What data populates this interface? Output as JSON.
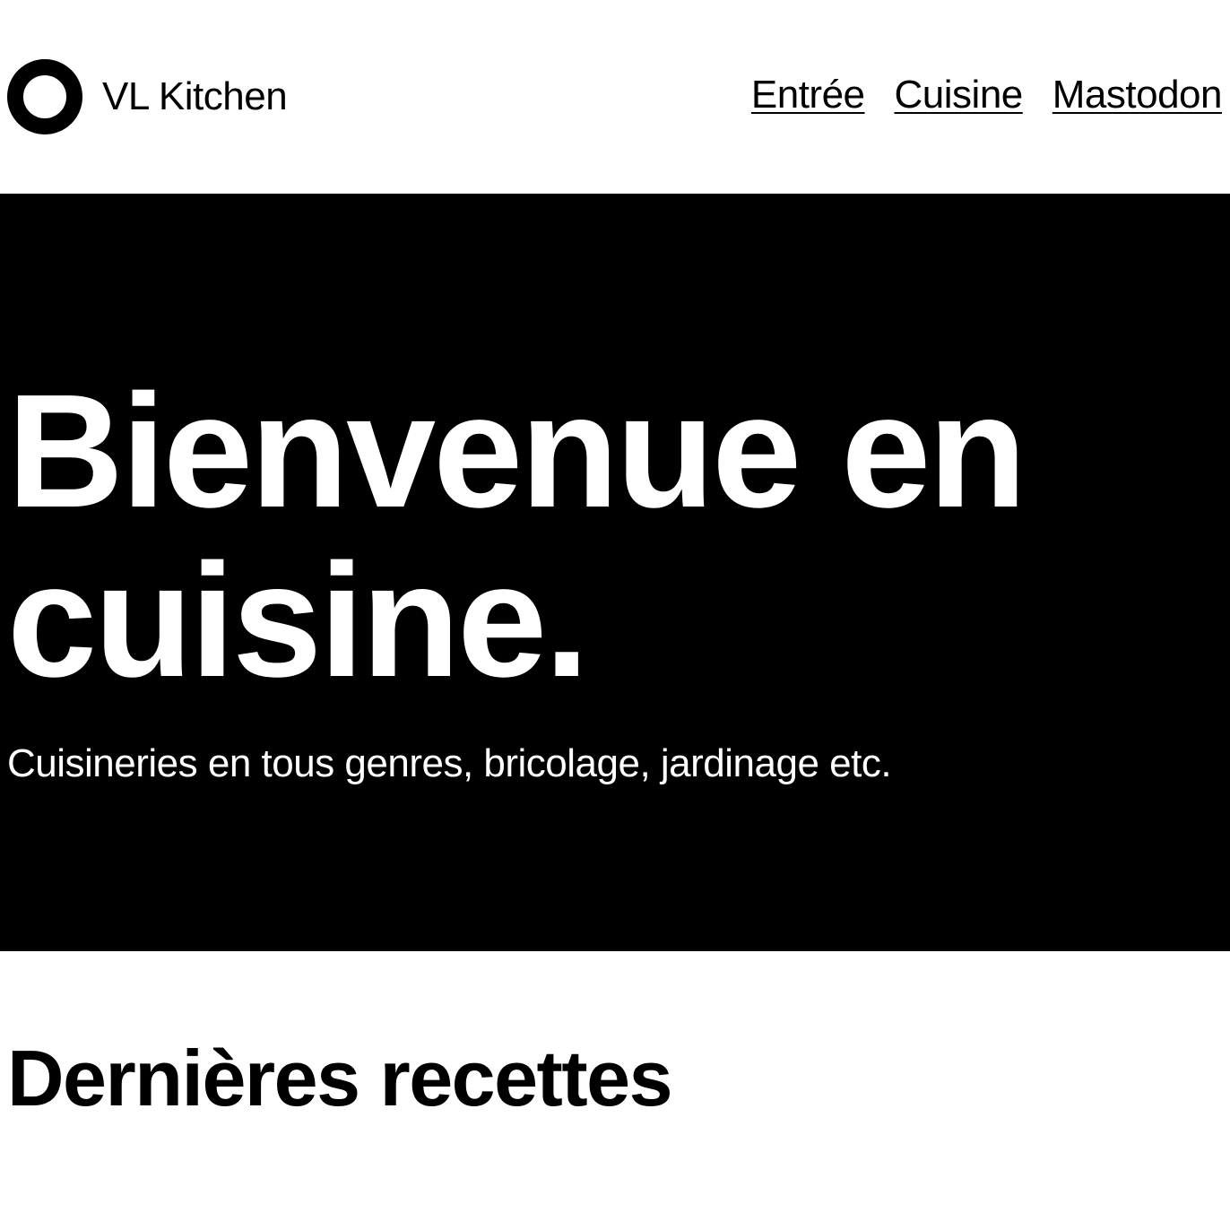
{
  "header": {
    "site_name": "VL Kitchen",
    "nav": [
      {
        "label": "Entrée"
      },
      {
        "label": "Cuisine"
      },
      {
        "label": "Mastodon"
      }
    ]
  },
  "hero": {
    "title": "Bienvenue en cuisine.",
    "subtitle": "Cuisineries en tous genres, bricolage, jardinage etc."
  },
  "main": {
    "section_title": "Dernières recettes"
  },
  "colors": {
    "background": "#ffffff",
    "hero_background": "#000000",
    "hero_text": "#ffffff",
    "text": "#000000"
  }
}
